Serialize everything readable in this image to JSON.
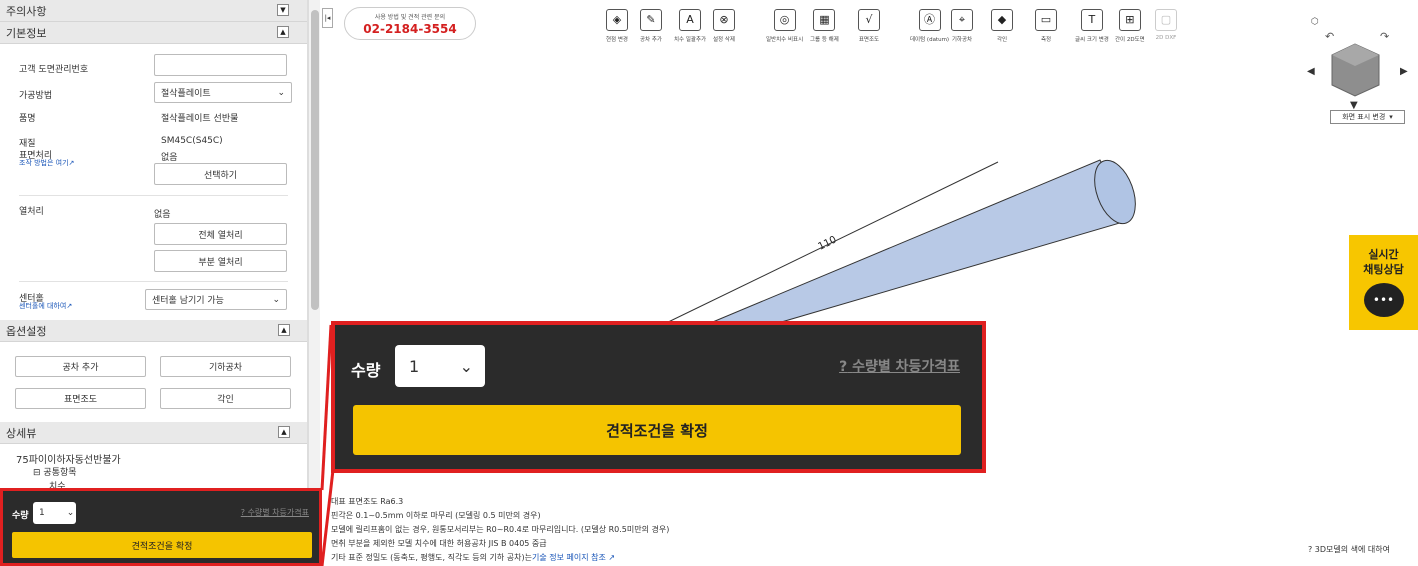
{
  "sidebar": {
    "caution": "주의사항",
    "basic": "기본정보",
    "fields": {
      "drawing_no_label": "고객 도면관리번호",
      "method_label": "가공방법",
      "method_value": "절삭플레이트",
      "item_label": "품명",
      "item_value": "절삭플레이트 선반물",
      "material_label": "재질",
      "material_value": "SM45C(S45C)",
      "surface_label": "표면처리",
      "surface_link": "조작 방법은 여기",
      "surface_value": "없음",
      "select_btn": "선택하기",
      "heat_label": "열처리",
      "heat_value": "없음",
      "heat_all_btn": "전체 열처리",
      "heat_part_btn": "부분 열처리",
      "center_label": "센터홀",
      "center_link": "센터홀에 대하여",
      "center_value": "센터홀 남기기 가능"
    },
    "options": {
      "title": "옵션설정",
      "btn1": "공차 추가",
      "btn2": "기하공차",
      "btn3": "표면조도",
      "btn4": "각인"
    },
    "detail": {
      "title": "상세뷰",
      "tree_title": "75파이이하자동선반불가",
      "node1": "공통항목",
      "node2": "치수"
    },
    "qty": {
      "label": "수량",
      "value": "1",
      "price_link": "수량별 차등가격표",
      "confirm": "견적조건을 확정"
    }
  },
  "header": {
    "phone_sub": "사용 방법 및 견적 관련 문의",
    "phone_num": "02-2184-3554"
  },
  "toolbar": [
    {
      "icon": "◈",
      "label": "현점 변경"
    },
    {
      "icon": "✎",
      "label": "공차 추가"
    },
    {
      "icon": "A",
      "label": "치수 일괄추가"
    },
    {
      "icon": "⊗",
      "label": "설정 삭제"
    },
    {
      "icon": "◎",
      "label": "일반치수 비표시"
    },
    {
      "icon": "▦",
      "label": "그룹 등 해제"
    },
    {
      "icon": "√",
      "label": "표면조도"
    },
    {
      "icon": "Ⓐ",
      "label": "데이텀 (datum)"
    },
    {
      "icon": "⌖",
      "label": "기하공차"
    },
    {
      "icon": "◆",
      "label": "각인"
    },
    {
      "icon": "▭",
      "label": "측정"
    },
    {
      "icon": "T",
      "label": "글씨 크기 변경"
    },
    {
      "icon": "⊞",
      "label": "간이 2D도면"
    },
    {
      "icon": "▢",
      "label": "2D DXF"
    }
  ],
  "viewcube": {
    "select": "화면 표시 변경"
  },
  "model": {
    "dimension": "110"
  },
  "chat": {
    "line1": "실시간",
    "line2": "채팅상담"
  },
  "notes": {
    "line1": "대표 표면조도 Ra6.3",
    "line2": "핀각은 0.1~0.5mm 이하로 마무리 (모델링 0.5 미만의 경우)",
    "line3": "모델에 릴리프홈이 없는 경우, 원통모서리부는 R0~R0.4로 마무리입니다. (모델상 R0.5미만의 경우)",
    "line4": "면취 부분을 제외한 모델 치수에 대한 허용공차 JIS B 0405 중급",
    "line5a": "기타 표준 정밀도 (동축도, 평행도, 직각도 등의 기하 공차)는",
    "line5b": "기술 정보 페이지 참조"
  },
  "about": "3D모델의 색에 대하여"
}
